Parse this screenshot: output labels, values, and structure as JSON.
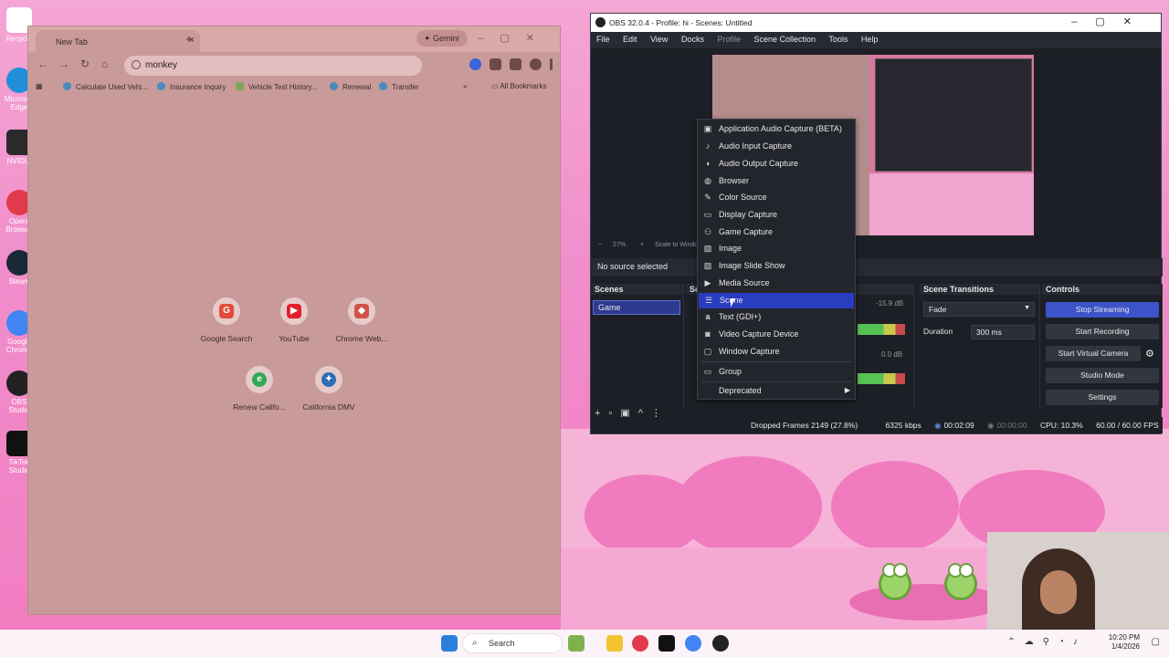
{
  "desktop": {
    "icons": [
      {
        "label": "Recycle",
        "icon": "recycle-bin-icon"
      },
      {
        "label": "Microsoft Edge",
        "icon": "edge-icon"
      },
      {
        "label": "NVIDIA",
        "icon": "nvidia-icon"
      },
      {
        "label": "Opera Browser",
        "icon": "opera-icon"
      },
      {
        "label": "Steam",
        "icon": "steam-icon"
      },
      {
        "label": "Google Chrome",
        "icon": "chrome-icon"
      },
      {
        "label": "OBS Studio",
        "icon": "obs-icon"
      },
      {
        "label": "TikTok Studio",
        "icon": "tiktok-icon"
      }
    ]
  },
  "chrome": {
    "tab_title": "New Tab",
    "gemini_label": "Gemini",
    "address_value": "monkey",
    "bookmarks": [
      {
        "label": "Calculate Used Vehi..."
      },
      {
        "label": "Insurance Inquiry"
      },
      {
        "label": "Vehicle Test History..."
      },
      {
        "label": "Renewal"
      },
      {
        "label": "Transfer"
      }
    ],
    "all_bookmarks": "All Bookmarks",
    "shortcuts": [
      {
        "label": "Google Search",
        "glyph": "G",
        "color": "#e14b3b"
      },
      {
        "label": "YouTube",
        "glyph": "▶",
        "color": "#e1202b"
      },
      {
        "label": "Chrome Web...",
        "glyph": "◆",
        "color": "#d0524a"
      },
      {
        "label": "Renew Califo...",
        "glyph": "e",
        "color": "#34a853"
      },
      {
        "label": "California DMV",
        "glyph": "✦",
        "color": "#2f6cb5"
      }
    ]
  },
  "obs": {
    "title": "OBS 32.0.4 - Profile: hi - Scenes: Untitled",
    "menu": [
      "File",
      "Edit",
      "View",
      "Docks",
      "Profile",
      "Scene Collection",
      "Tools",
      "Help"
    ],
    "zoom": "27%",
    "scale_label": "Scale to Windo",
    "no_source": "No source selected",
    "scenes_title": "Scenes",
    "scene_item": "Game",
    "sources_title": "Sc",
    "transitions_title": "Scene Transitions",
    "transition_value": "Fade",
    "duration_label": "Duration",
    "duration_value": "300 ms",
    "controls_title": "Controls",
    "controls": [
      "Stop Streaming",
      "Start Recording",
      "Start Virtual Camera",
      "Studio Mode",
      "Settings"
    ],
    "mixer_db1": "-15.9 dB",
    "mixer_db2": "0.0 dB",
    "status": {
      "dropped": "Dropped Frames 2149 (27.8%)",
      "kbps": "6325 kbps",
      "stream_time": "00:02:09",
      "rec_time": "00:00:00",
      "cpu": "CPU: 10.3%",
      "fps": "60.00 / 60.00 FPS"
    },
    "context_menu": [
      {
        "label": "Application Audio Capture (BETA)",
        "icon": "app-audio-icon",
        "glyph": "▣"
      },
      {
        "label": "Audio Input Capture",
        "icon": "microphone-icon",
        "glyph": "🎙"
      },
      {
        "label": "Audio Output Capture",
        "icon": "speaker-icon",
        "glyph": "🔊"
      },
      {
        "label": "Browser",
        "icon": "globe-icon",
        "glyph": "◍"
      },
      {
        "label": "Color Source",
        "icon": "palette-icon",
        "glyph": "✎"
      },
      {
        "label": "Display Capture",
        "icon": "monitor-icon",
        "glyph": "▭"
      },
      {
        "label": "Game Capture",
        "icon": "gamepad-icon",
        "glyph": "⚇"
      },
      {
        "label": "Image",
        "icon": "image-icon",
        "glyph": "▨"
      },
      {
        "label": "Image Slide Show",
        "icon": "slideshow-icon",
        "glyph": "▧"
      },
      {
        "label": "Media Source",
        "icon": "play-icon",
        "glyph": "▶"
      },
      {
        "label": "Scene",
        "icon": "list-icon",
        "glyph": "☰"
      },
      {
        "label": "Text (GDI+)",
        "icon": "text-icon",
        "glyph": "a"
      },
      {
        "label": "Video Capture Device",
        "icon": "camera-icon",
        "glyph": "◙"
      },
      {
        "label": "Window Capture",
        "icon": "window-icon",
        "glyph": "▢"
      }
    ],
    "group_label": "Group",
    "deprecated_label": "Deprecated"
  },
  "taskbar": {
    "search": "Search",
    "time": "10:20 PM",
    "date": "1/4/2026"
  }
}
